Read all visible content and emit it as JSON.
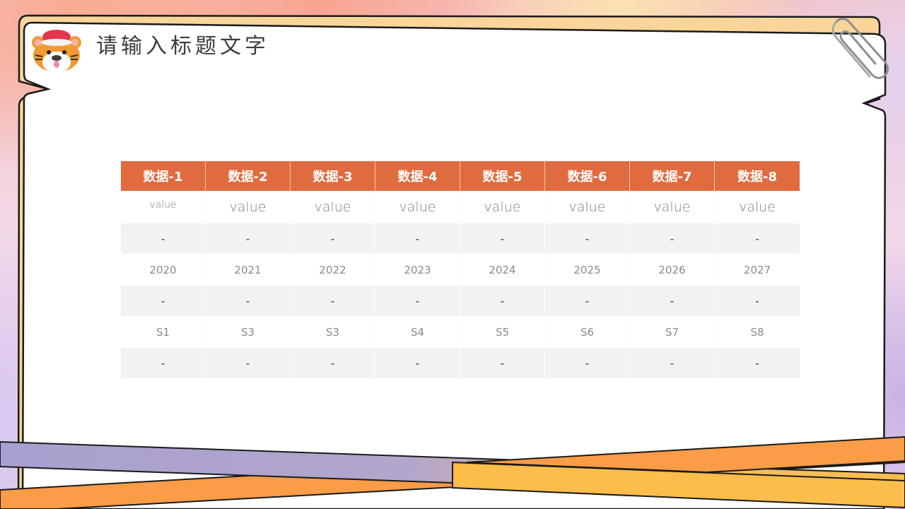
{
  "slide": {
    "title": "请输入标题文字",
    "mascot": "tiger-mascot-with-santa-hat",
    "decorations": [
      "paperclip",
      "diagonal-ribbons"
    ]
  },
  "colors": {
    "header_bg": "#e06b3f",
    "header_text": "#ffffff",
    "stripe_row_bg": "#f2f2f2",
    "card_border": "#f9d59a",
    "ribbon_purple": "#a9a0d0",
    "ribbon_orange": "#fb9c47",
    "ribbon_yellow": "#fcbd4a",
    "title_text": "#3c3c3c"
  },
  "table": {
    "headers": [
      "数据-1",
      "数据-2",
      "数据-3",
      "数据-4",
      "数据-5",
      "数据-6",
      "数据-7",
      "数据-8"
    ],
    "rows": [
      [
        "value",
        "value",
        "value",
        "value",
        "value",
        "value",
        "value",
        "value"
      ],
      [
        "-",
        "-",
        "-",
        "-",
        "-",
        "-",
        "-",
        "-"
      ],
      [
        "2020",
        "2021",
        "2022",
        "2023",
        "2024",
        "2025",
        "2026",
        "2027"
      ],
      [
        "-",
        "-",
        "-",
        "-",
        "-",
        "-",
        "-",
        "-"
      ],
      [
        "S1",
        "S3",
        "S3",
        "S4",
        "S5",
        "S6",
        "S7",
        "S8"
      ],
      [
        "-",
        "-",
        "-",
        "-",
        "-",
        "-",
        "-",
        "-"
      ]
    ]
  }
}
